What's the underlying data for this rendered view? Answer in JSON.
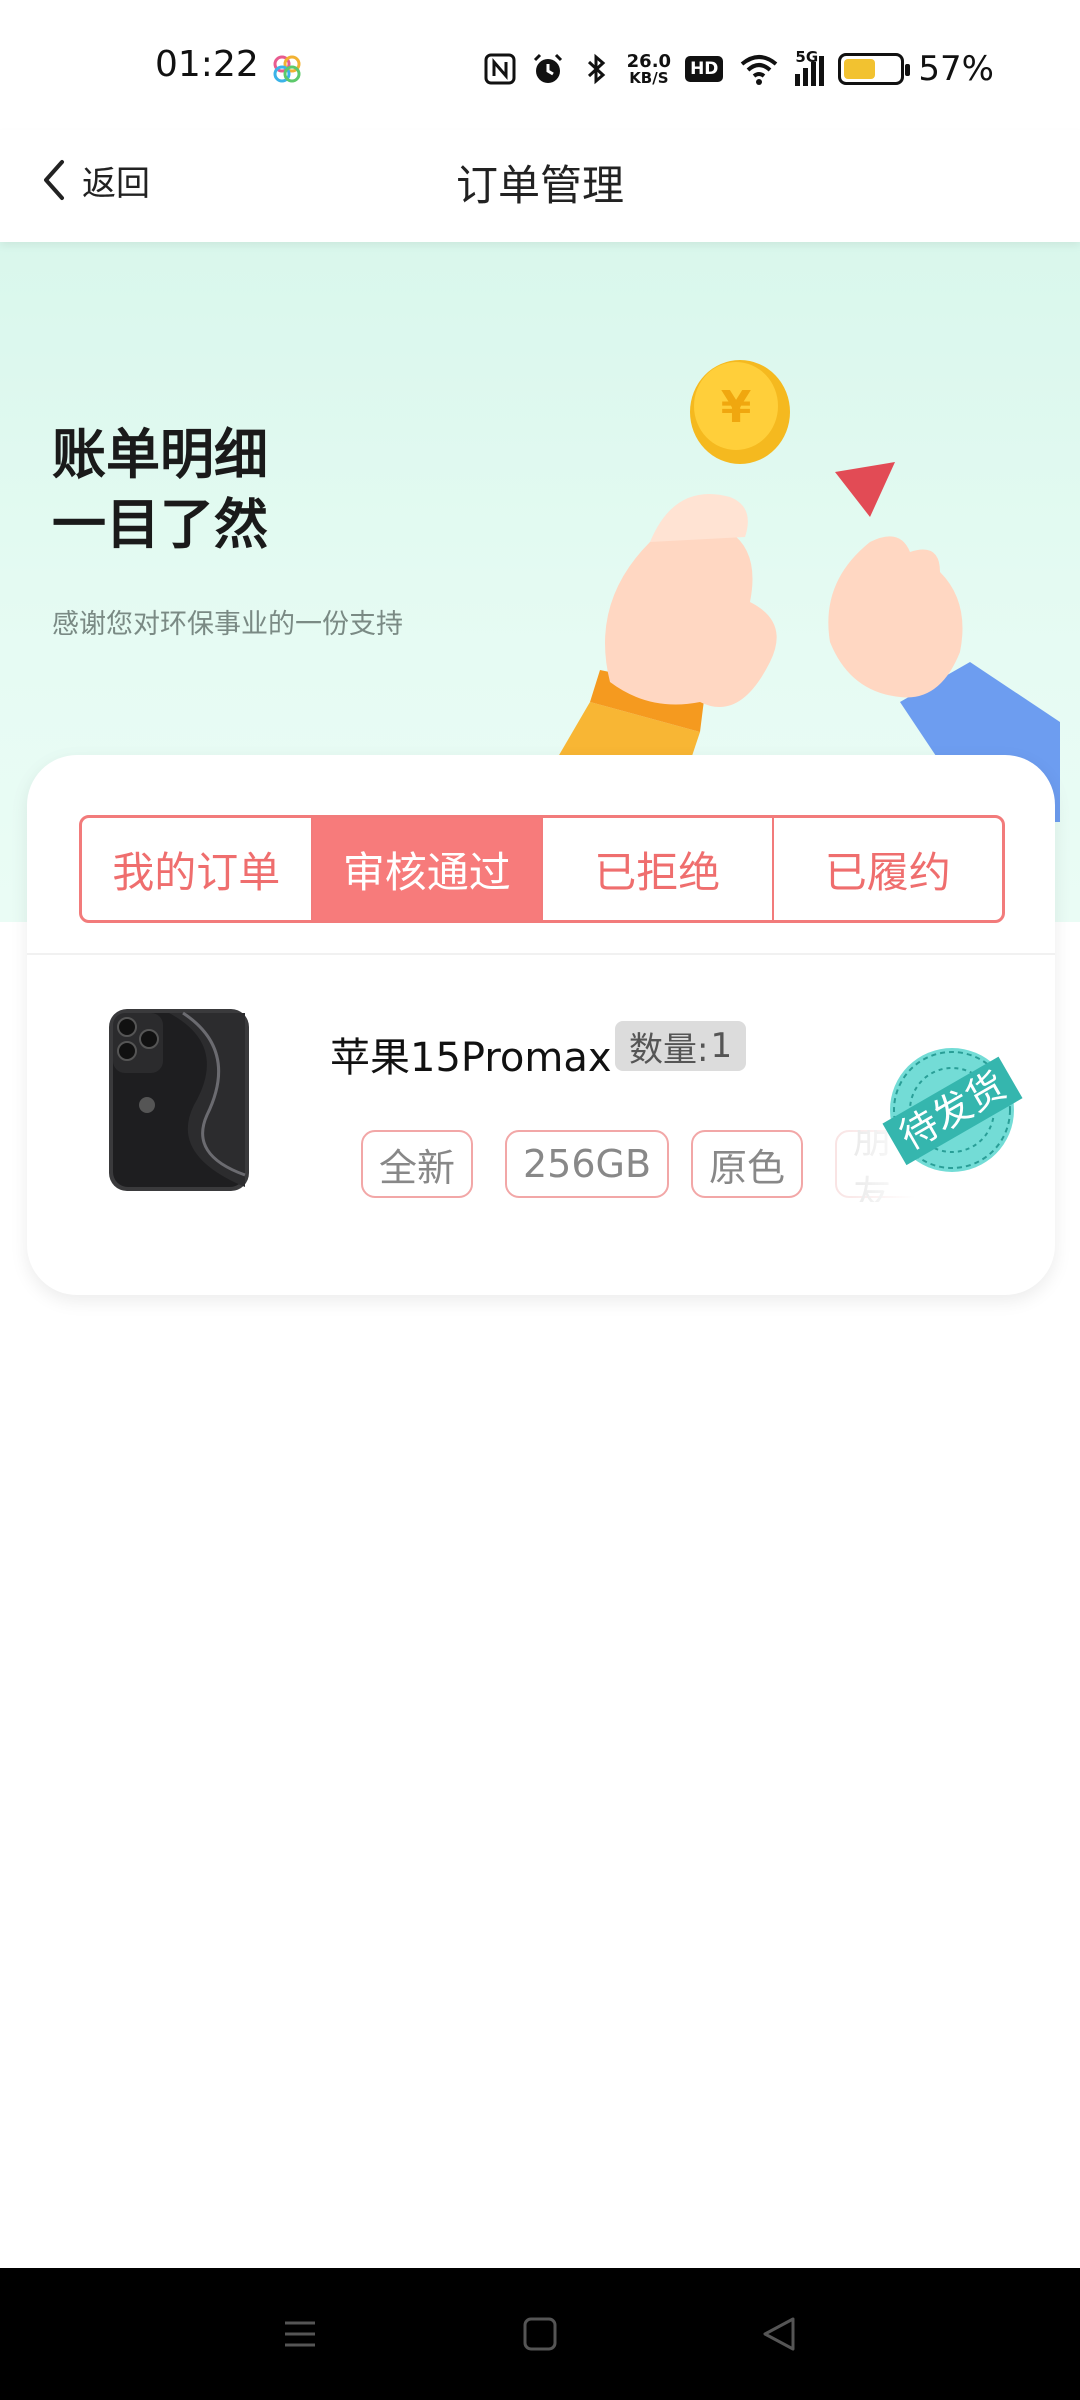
{
  "status_bar": {
    "time": "01:22",
    "network_speed_value": "26.0",
    "network_speed_unit": "KB/S",
    "hd_label": "HD",
    "signal_label": "5G",
    "battery_percent_text": "57%",
    "battery_level": 0.57,
    "battery_color": "#f2c230"
  },
  "header": {
    "back_label": "返回",
    "title": "订单管理"
  },
  "banner": {
    "title": "账单明细\n一目了然",
    "subtitle": "感谢您对环保事业的一份支持"
  },
  "tabs": [
    {
      "label": "我的订单",
      "active": false
    },
    {
      "label": "审核通过",
      "active": true
    },
    {
      "label": "已拒绝",
      "active": false
    },
    {
      "label": "已履约",
      "active": false
    }
  ],
  "order": {
    "product_name": "苹果15Promax",
    "quantity_label": "数量:",
    "quantity": "1",
    "specs": [
      "全新",
      "256GB",
      "原色",
      "朋友"
    ],
    "status_stamp": "待发货"
  },
  "colors": {
    "accent": "#f77b7b",
    "banner_bg": "#d9f7ec",
    "stamp": "#3fc9c3"
  },
  "icons": {
    "back": "chevron-left-icon",
    "nav_menu": "menu-icon",
    "nav_home": "square-home-icon",
    "nav_back": "triangle-back-icon"
  }
}
